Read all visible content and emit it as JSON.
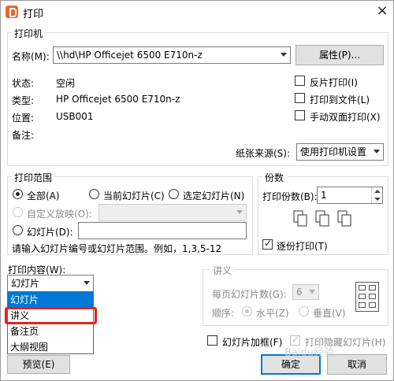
{
  "window": {
    "title": "打印"
  },
  "printer": {
    "legend": "打印机",
    "name_label": "名称(M):",
    "name_value": "\\\\hd\\HP Officejet 6500 E710n-z",
    "properties_button": "属性(P)...",
    "status_label": "状态:",
    "status_value": "空闲",
    "type_label": "类型:",
    "type_value": "HP Officejet 6500 E710n-z",
    "location_label": "位置:",
    "location_value": "USB001",
    "comment_label": "备注:",
    "reverse_print": "反片打印(I)",
    "print_to_file": "打印到文件(L)",
    "manual_duplex": "手动双面打印(X)",
    "paper_source_label": "纸张来源(S):",
    "paper_source_value": "使用打印机设置"
  },
  "range": {
    "legend": "打印范围",
    "all": "全部(A)",
    "current_slide": "当前幻灯片(C)",
    "selected_slides": "选定幻灯片(N)",
    "custom_show": "自定义放映(O):",
    "slides": "幻灯片(D):",
    "hint": "请输入幻灯片编号或幻灯片范围。例如，1,3,5-12"
  },
  "copies": {
    "legend": "份数",
    "count_label": "打印份数(B):",
    "count_value": "1",
    "collate": "逐份打印(T)"
  },
  "content": {
    "label": "打印内容(W):",
    "selected": "幻灯片",
    "options": [
      "幻灯片",
      "讲义",
      "备注页",
      "大纲视图"
    ]
  },
  "handouts": {
    "legend": "讲义",
    "per_page_label": "每页幻灯片数(G):",
    "per_page_value": "6",
    "order_label": "顺序:",
    "horizontal": "水平(Z)",
    "vertical": "垂直(V)"
  },
  "options": {
    "frame_slides": "幻灯片加框(F)",
    "print_hidden": "打印隐藏幻灯片(H)"
  },
  "buttons": {
    "preview": "预览(E)",
    "ok": "确定",
    "cancel": "取消"
  },
  "watermark": "Baidu经验"
}
